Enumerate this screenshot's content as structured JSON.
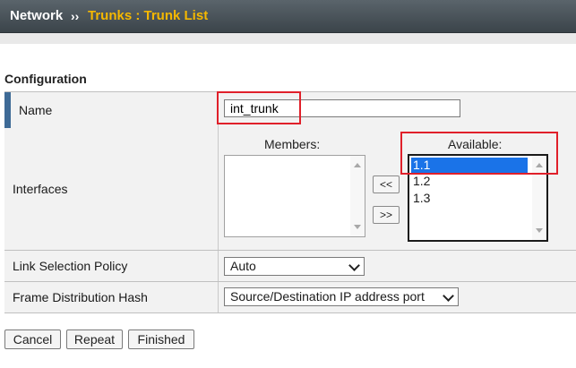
{
  "breadcrumb": {
    "section": "Network",
    "separator": "››",
    "page": "Trunks : Trunk List"
  },
  "section_title": "Configuration",
  "fields": {
    "name": {
      "label": "Name",
      "value": "int_trunk"
    },
    "interfaces": {
      "label": "Interfaces",
      "members_title": "Members:",
      "available_title": "Available:",
      "members": [],
      "available": [
        "1.1",
        "1.2",
        "1.3"
      ],
      "selected_available": "1.1",
      "add_label": "<<",
      "remove_label": ">>"
    },
    "link_selection_policy": {
      "label": "Link Selection Policy",
      "value": "Auto"
    },
    "frame_distribution_hash": {
      "label": "Frame Distribution Hash",
      "value": "Source/Destination IP address port"
    }
  },
  "actions": {
    "cancel": "Cancel",
    "repeat": "Repeat",
    "finished": "Finished"
  },
  "colors": {
    "header_bg": "#3b444a",
    "breadcrumb_page": "#f5b800",
    "highlight": "#e0202a",
    "selection": "#1a73e8",
    "accent": "#3e6a96"
  }
}
